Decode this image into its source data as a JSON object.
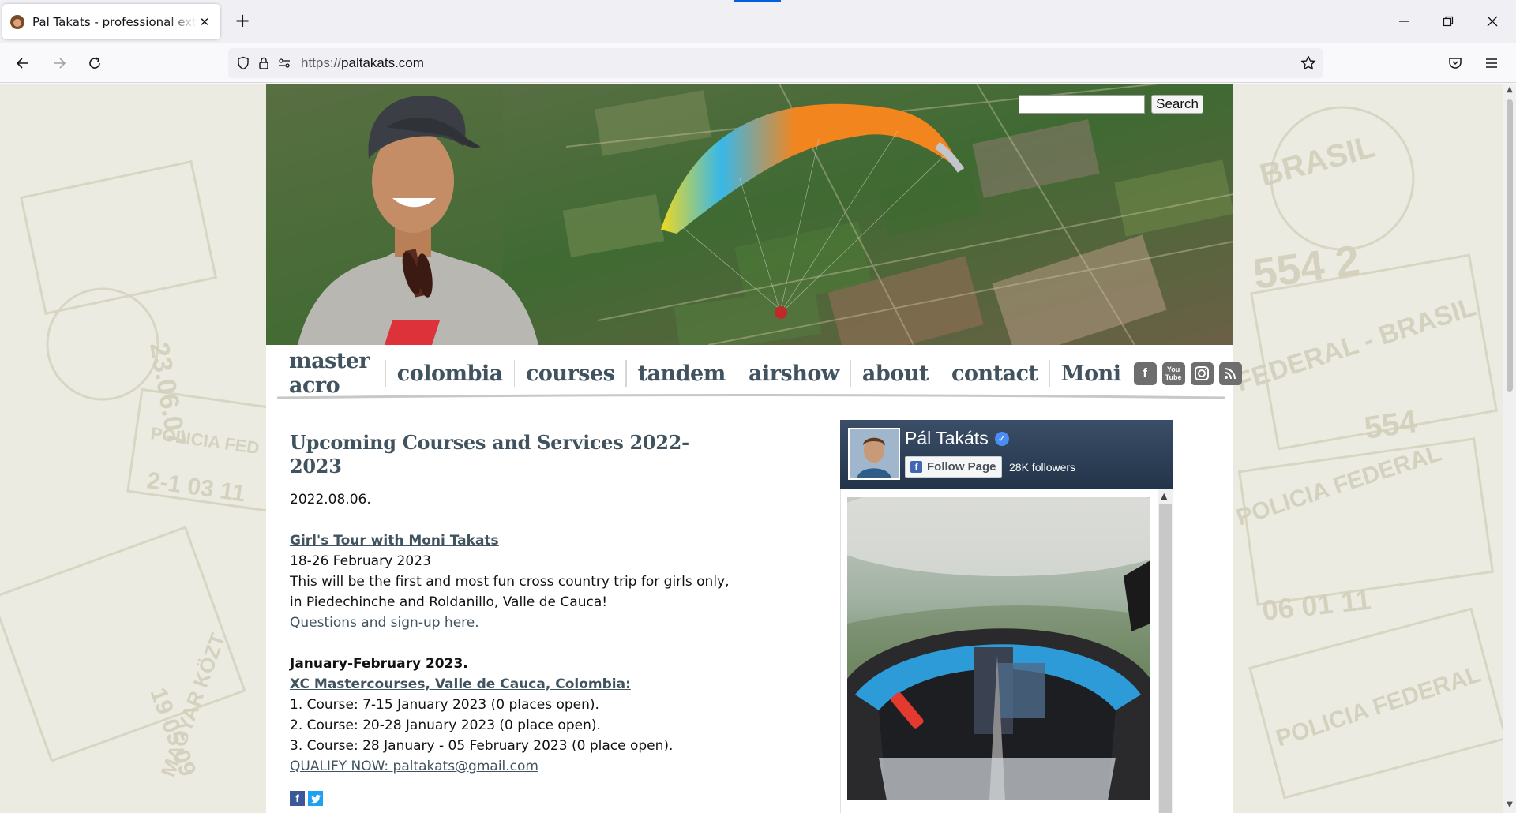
{
  "browser": {
    "tab_title": "Pal Takats - professional extreme",
    "url_scheme": "https://",
    "url_host": "paltakats.com"
  },
  "search": {
    "button_label": "Search",
    "placeholder": ""
  },
  "nav": {
    "items": [
      "master acro",
      "colombia",
      "courses",
      "tandem",
      "airshow",
      "about",
      "contact",
      "Moni"
    ],
    "social": [
      "facebook-icon",
      "youtube-icon",
      "instagram-icon",
      "rss-icon"
    ],
    "youtube_label": "You Tube"
  },
  "post": {
    "title": "Upcoming Courses and Services 2022-2023",
    "date": "2022.08.06.",
    "girls_tour_link": "Girl's Tour with Moni Takats",
    "girls_tour_dates": "18-26 February 2023",
    "girls_tour_desc": "This will be the first and most fun cross country trip for girls only, in Piedechinche and Roldanillo, Valle de Cauca!",
    "signup_link": "Questions and sign-up here.",
    "period": "January-February 2023.",
    "xc_link": "XC Mastercourses, Valle de Cauca, Colombia:",
    "courses": [
      "1. Course: 7-15 January 2023 (0 places open).",
      "2. Course: 20-28 January 2023 (0 place open).",
      "3. Course: 28 January - 05 February 2023 (0 place open)."
    ],
    "qualify_link": "QUALIFY NOW: paltakats@gmail.com",
    "share_icons": [
      "facebook-share-icon",
      "twitter-share-icon"
    ]
  },
  "facebook_widget": {
    "page_name": "Pál Takáts",
    "follow_label": "Follow Page",
    "followers": "28K followers"
  },
  "colors": {
    "link": "#41535f",
    "nav_text": "#41535f",
    "fb_blue": "#4267b2",
    "twitter_blue": "#1da1f2"
  }
}
